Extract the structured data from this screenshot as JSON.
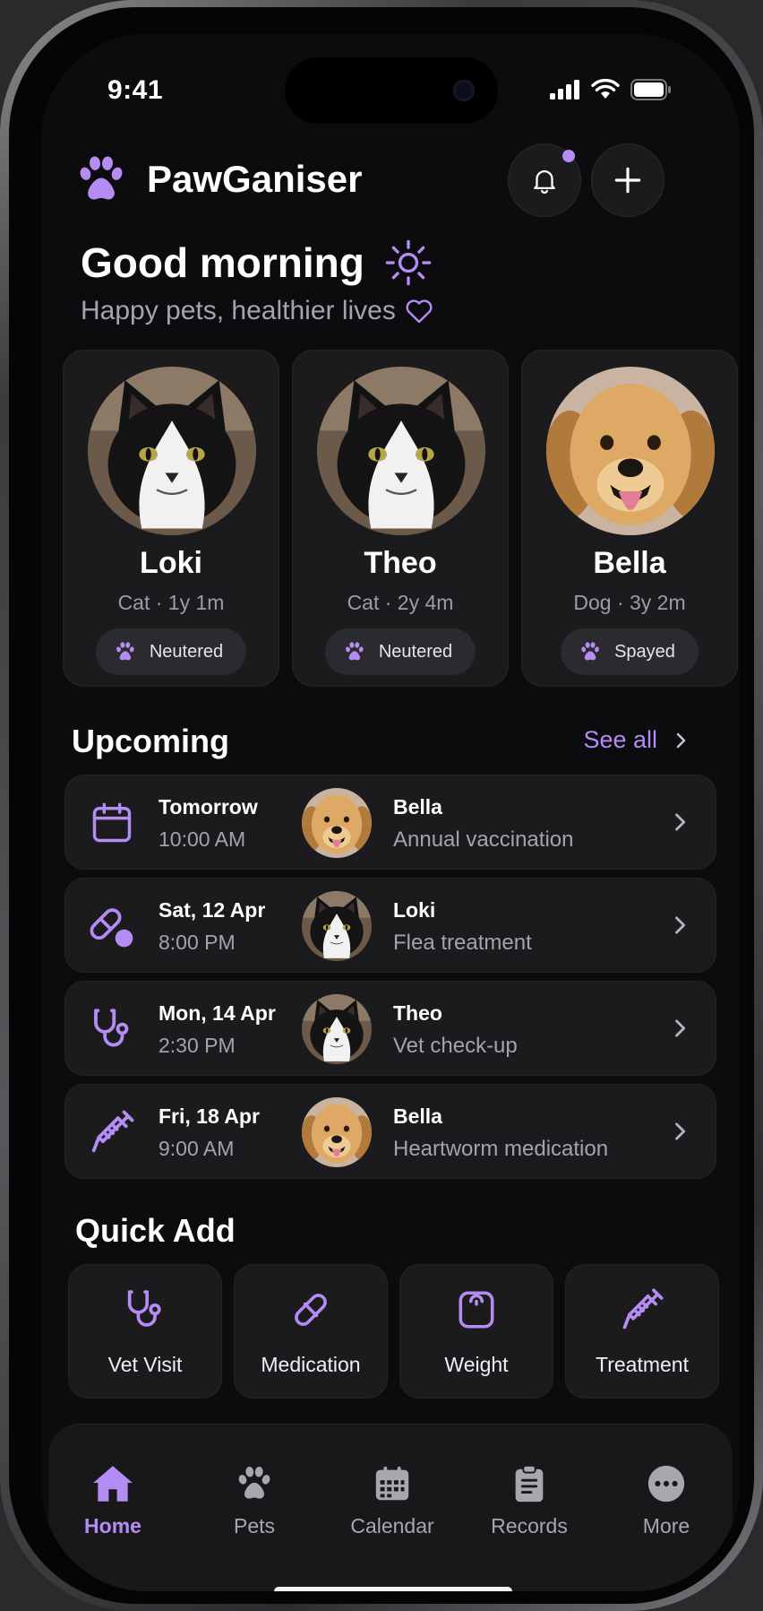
{
  "status": {
    "time": "9:41"
  },
  "header": {
    "app_name": "PawGaniser",
    "notification_icon": "bell-icon",
    "add_icon": "plus-icon"
  },
  "greeting": {
    "title": "Good morning",
    "subtitle": "Happy pets, healthier lives"
  },
  "pets": [
    {
      "name": "Loki",
      "info": "Cat · 1y 1m",
      "status": "Neutered",
      "photo": "cat-photo"
    },
    {
      "name": "Theo",
      "info": "Cat · 2y 4m",
      "status": "Neutered",
      "photo": "cat-photo"
    },
    {
      "name": "Bella",
      "info": "Dog · 3y 2m",
      "status": "Spayed",
      "photo": "dog-photo"
    }
  ],
  "upcoming": {
    "title": "Upcoming",
    "see_all": "See all",
    "items": [
      {
        "icon": "calendar-icon",
        "date": "Tomorrow",
        "time": "10:00 AM",
        "pet": "Bella",
        "task": "Annual vaccination"
      },
      {
        "icon": "pill-icon",
        "date": "Sat, 12 Apr",
        "time": "8:00 PM",
        "pet": "Loki",
        "task": "Flea treatment"
      },
      {
        "icon": "stethoscope-icon",
        "date": "Mon, 14 Apr",
        "time": "2:30 PM",
        "pet": "Theo",
        "task": "Vet check-up"
      },
      {
        "icon": "syringe-icon",
        "date": "Fri, 18 Apr",
        "time": "9:00 AM",
        "pet": "Bella",
        "task": "Heartworm medication"
      }
    ]
  },
  "quick_add": {
    "title": "Quick Add",
    "items": [
      {
        "label": "Vet Visit",
        "icon": "stethoscope-icon"
      },
      {
        "label": "Medication",
        "icon": "pill-icon"
      },
      {
        "label": "Weight",
        "icon": "scale-icon"
      },
      {
        "label": "Treatment",
        "icon": "syringe-icon"
      }
    ]
  },
  "tabs": [
    {
      "label": "Home",
      "icon": "home-icon",
      "active": true
    },
    {
      "label": "Pets",
      "icon": "paw-icon",
      "active": false
    },
    {
      "label": "Calendar",
      "icon": "calendar-icon",
      "active": false
    },
    {
      "label": "Records",
      "icon": "clipboard-icon",
      "active": false
    },
    {
      "label": "More",
      "icon": "more-icon",
      "active": false
    }
  ],
  "colors": {
    "accent": "#b58cf4",
    "background": "#0c0c0e",
    "card": "#1b1b1e",
    "muted_text": "#a5a2ae"
  }
}
